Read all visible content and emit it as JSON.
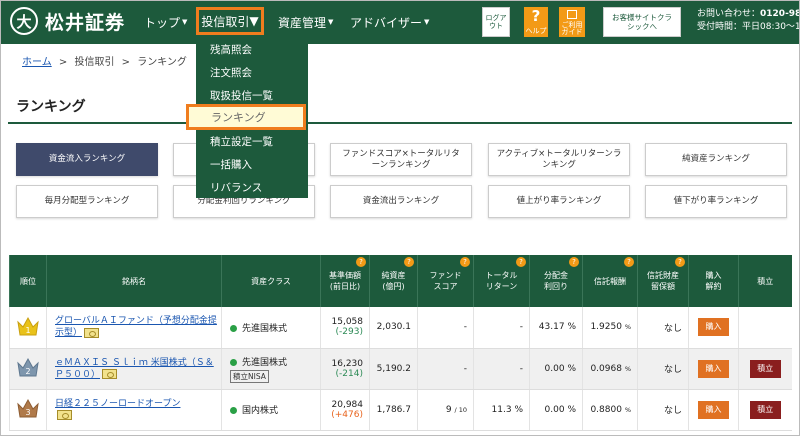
{
  "header": {
    "logo_mark": "大",
    "logo_text": "松井証券",
    "nav": [
      {
        "label": "トップ"
      },
      {
        "label": "投信取引"
      },
      {
        "label": "資産管理"
      },
      {
        "label": "アドバイザー"
      }
    ],
    "logout_label": "ログアウト",
    "help_label": "ヘルプ",
    "guide_label": "ご利用ガイド",
    "classic_label": "お客様サイトクラシックへ",
    "contact_prefix": "お問い合わせ：",
    "contact_phone": "0120-981-486",
    "hours": "受付時間：平日08:30～17:00"
  },
  "dropdown": {
    "items": [
      "残高照会",
      "注文照会",
      "取扱投信一覧",
      "ランキング",
      "積立設定一覧",
      "一括購入",
      "リバランス"
    ]
  },
  "breadcrumb": {
    "home": "ホーム",
    "sep": ">",
    "mid": "投信取引",
    "current": "ランキング"
  },
  "page_title": "ランキング",
  "ranking_buttons": [
    {
      "label": "資金流入ランキング"
    },
    {
      "label": "ト"
    },
    {
      "label": "ファンドスコア×トータルリターンランキング"
    },
    {
      "label": "アクティブ×トータルリターンランキング"
    },
    {
      "label": "純資産ランキング"
    },
    {
      "label": "毎月分配型ランキング"
    },
    {
      "label": "分配金利回りランキング"
    },
    {
      "label": "資金流出ランキング"
    },
    {
      "label": "値上がり率ランキング"
    },
    {
      "label": "値下がり率ランキング"
    }
  ],
  "table": {
    "headers": {
      "rank": "順位",
      "name": "銘柄名",
      "asset": "資産クラス",
      "nav1": "基準価額",
      "nav2": "(前日比)",
      "na1": "純資産",
      "na2": "(億円)",
      "fs1": "ファンド",
      "fs2": "スコア",
      "tr1": "トータル",
      "tr2": "リターン",
      "dy1": "分配金",
      "dy2": "利回り",
      "fee": "信託報酬",
      "rf1": "信託財産",
      "rf2": "留保額",
      "bs1": "購入",
      "bs2": "解約",
      "acc": "積立"
    },
    "rows": [
      {
        "rank": "1",
        "crown_color": "#e9c21a",
        "name": "グローバルＡＩファンド（予想分配金提示型）",
        "asset": "先進国株式",
        "asset_color": "#2aa046",
        "nisa": "",
        "nav": "15,058",
        "change": "(-293)",
        "net_assets": "2,030.1",
        "fund_score": "-",
        "fund_score_unit": "",
        "total_return": "-",
        "yield": "43.17",
        "yield_unit": "%",
        "fee": "1.9250",
        "fee_unit": "%",
        "reserve": "なし",
        "buy": "購入",
        "accumulate": ""
      },
      {
        "rank": "2",
        "crown_color": "#7e96ad",
        "name": "ｅＭＡＸＩＳ Ｓｌｉｍ 米国株式（Ｓ＆Ｐ５００）",
        "asset": "先進国株式",
        "asset_color": "#2aa046",
        "nisa": "積立NISA",
        "nav": "16,230",
        "change": "(-214)",
        "net_assets": "5,190.2",
        "fund_score": "-",
        "fund_score_unit": "",
        "total_return": "-",
        "yield": "0.00",
        "yield_unit": "%",
        "fee": "0.0968",
        "fee_unit": "%",
        "reserve": "なし",
        "buy": "購入",
        "accumulate": "積立"
      },
      {
        "rank": "3",
        "crown_color": "#b07a4a",
        "name": "日経２２５ノーロードオープン",
        "asset": "国内株式",
        "asset_color": "#2aa046",
        "nisa": "",
        "nav": "20,984",
        "change": "(+476)",
        "net_assets": "1,786.7",
        "fund_score": "9",
        "fund_score_unit": "/ 10",
        "total_return": "11.3 %",
        "yield": "0.00",
        "yield_unit": "%",
        "fee": "0.8800",
        "fee_unit": "%",
        "reserve": "なし",
        "buy": "購入",
        "accumulate": "積立"
      }
    ]
  }
}
